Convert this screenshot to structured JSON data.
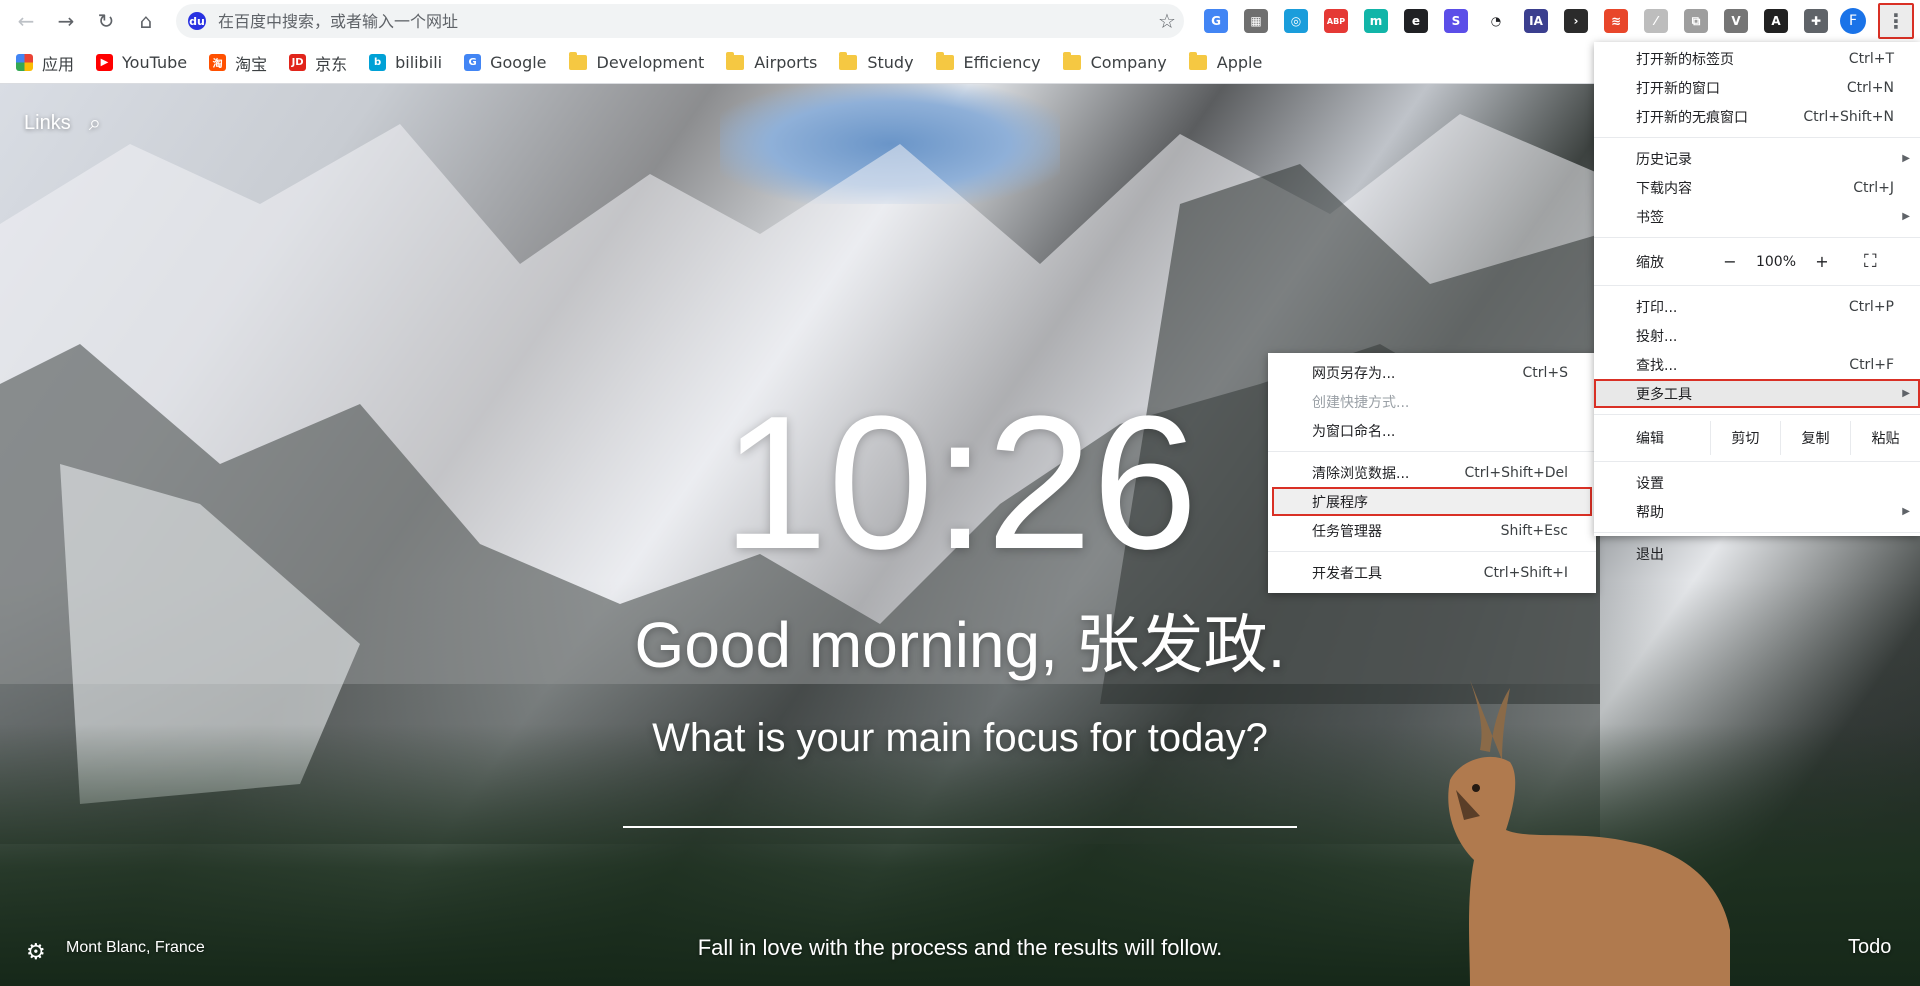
{
  "toolbar": {
    "omnibox_placeholder": "在百度中搜索，或者输入一个网址",
    "profile_initial": "F"
  },
  "extensions": [
    {
      "name": "translate-ext",
      "bg": "#4285f4",
      "glyph": "G"
    },
    {
      "name": "tab-ext",
      "bg": "#6f6f6f",
      "glyph": "▦"
    },
    {
      "name": "search-ext",
      "bg": "#1a9ddb",
      "glyph": "◎"
    },
    {
      "name": "adblock-ext",
      "bg": "#e53935",
      "glyph": "ABP"
    },
    {
      "name": "m-ext",
      "bg": "#12b5a8",
      "glyph": "m"
    },
    {
      "name": "e-ext",
      "bg": "#202124",
      "glyph": "e"
    },
    {
      "name": "s-ext",
      "bg": "#5b4ee8",
      "glyph": "S"
    },
    {
      "name": "speed-ext",
      "bg": "#ffffff",
      "glyph": "◔"
    },
    {
      "name": "ia-ext",
      "bg": "#3b3f8f",
      "glyph": "IA"
    },
    {
      "name": "term-ext",
      "bg": "#2b2b2b",
      "glyph": "›"
    },
    {
      "name": "stack-ext",
      "bg": "#e8462a",
      "glyph": "≋"
    },
    {
      "name": "pdf-ext",
      "bg": "#bdbdbd",
      "glyph": "⁄"
    },
    {
      "name": "copy-ext",
      "bg": "#9e9e9e",
      "glyph": "⧉"
    },
    {
      "name": "v-ext",
      "bg": "#757575",
      "glyph": "V"
    },
    {
      "name": "dict-ext",
      "bg": "#212121",
      "glyph": "A"
    },
    {
      "name": "puzzle-ext",
      "bg": "#5f6368",
      "glyph": "✚"
    }
  ],
  "bookmarks": [
    {
      "label": "应用",
      "type": "apps"
    },
    {
      "label": "YouTube",
      "type": "site",
      "color": "#ff0000",
      "glyph": "▶"
    },
    {
      "label": "淘宝",
      "type": "site",
      "color": "#ff5000",
      "glyph": "淘"
    },
    {
      "label": "京东",
      "type": "site",
      "color": "#e1251b",
      "glyph": "JD"
    },
    {
      "label": "bilibili",
      "type": "site",
      "color": "#00a1d6",
      "glyph": "b"
    },
    {
      "label": "Google",
      "type": "site",
      "color": "#4285f4",
      "glyph": "G"
    },
    {
      "label": "Development",
      "type": "folder"
    },
    {
      "label": "Airports",
      "type": "folder"
    },
    {
      "label": "Study",
      "type": "folder"
    },
    {
      "label": "Efficiency",
      "type": "folder"
    },
    {
      "label": "Company",
      "type": "folder"
    },
    {
      "label": "Apple",
      "type": "folder"
    }
  ],
  "page": {
    "links_label": "Links",
    "time": "10:26",
    "greeting": "Good morning, 张发政.",
    "focus_question": "What is your main focus for today?",
    "location": "Mont Blanc, France",
    "quote": "Fall in love with the process and the results will follow.",
    "todo": "Todo"
  },
  "main_menu": {
    "new_tab": {
      "label": "打开新的标签页",
      "shortcut": "Ctrl+T"
    },
    "new_window": {
      "label": "打开新的窗口",
      "shortcut": "Ctrl+N"
    },
    "new_incognito": {
      "label": "打开新的无痕窗口",
      "shortcut": "Ctrl+Shift+N"
    },
    "history": {
      "label": "历史记录"
    },
    "downloads": {
      "label": "下载内容",
      "shortcut": "Ctrl+J"
    },
    "bookmarks": {
      "label": "书签"
    },
    "zoom": {
      "label": "缩放",
      "minus": "−",
      "value": "100%",
      "plus": "+"
    },
    "print": {
      "label": "打印...",
      "shortcut": "Ctrl+P"
    },
    "cast": {
      "label": "投射..."
    },
    "find": {
      "label": "查找...",
      "shortcut": "Ctrl+F"
    },
    "more_tools": {
      "label": "更多工具"
    },
    "edit": {
      "label": "编辑",
      "cut": "剪切",
      "copy": "复制",
      "paste": "粘贴"
    },
    "settings": {
      "label": "设置"
    },
    "help": {
      "label": "帮助"
    },
    "exit": {
      "label": "退出"
    }
  },
  "sub_menu": {
    "save_page": {
      "label": "网页另存为...",
      "shortcut": "Ctrl+S"
    },
    "create_shortcut": {
      "label": "创建快捷方式..."
    },
    "name_window": {
      "label": "为窗口命名..."
    },
    "clear_data": {
      "label": "清除浏览数据...",
      "shortcut": "Ctrl+Shift+Del"
    },
    "extensions": {
      "label": "扩展程序"
    },
    "task_manager": {
      "label": "任务管理器",
      "shortcut": "Shift+Esc"
    },
    "dev_tools": {
      "label": "开发者工具",
      "shortcut": "Ctrl+Shift+I"
    }
  }
}
